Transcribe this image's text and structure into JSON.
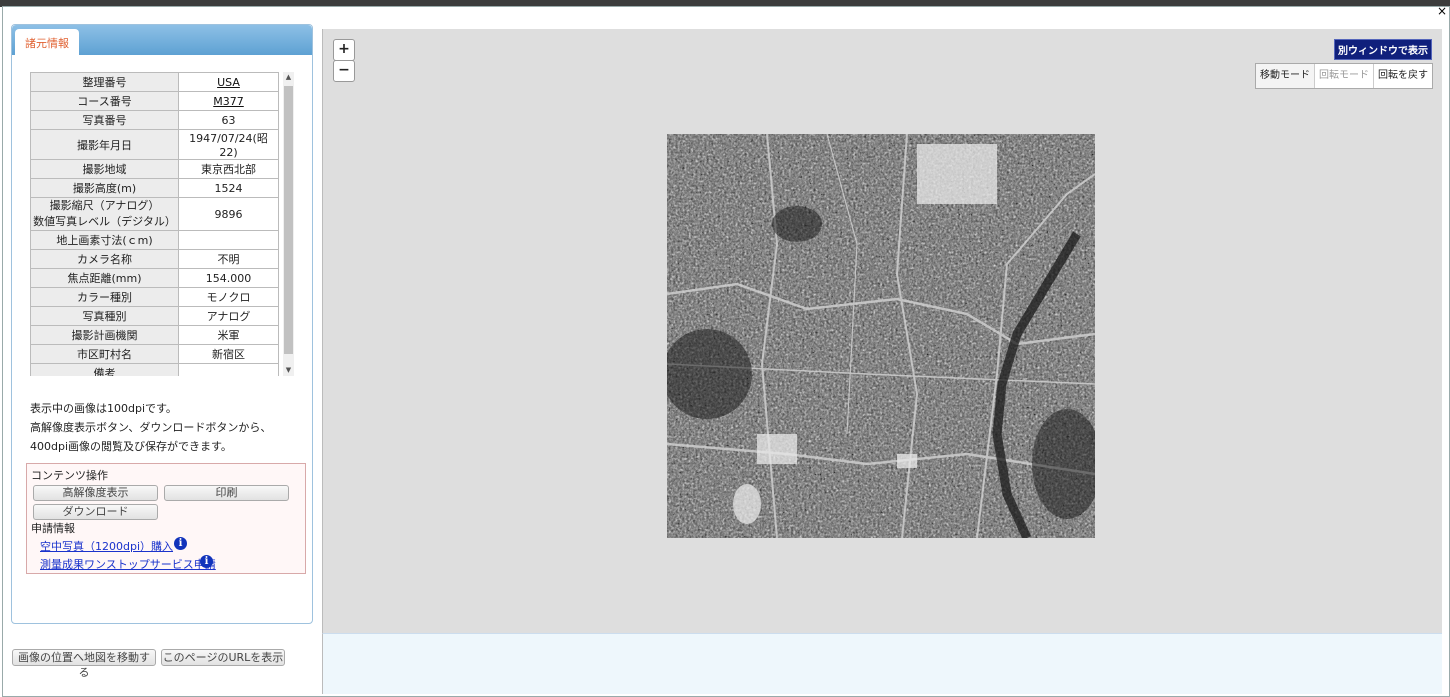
{
  "dialog": {
    "close_glyph": "×"
  },
  "left": {
    "tab": "諸元情報",
    "rows": [
      {
        "k": "整理番号",
        "v": "USA"
      },
      {
        "k": "コース番号",
        "v": "M377"
      },
      {
        "k": "写真番号",
        "v": "63"
      },
      {
        "k": "撮影年月日",
        "v": "1947/07/24(昭22)"
      },
      {
        "k": "撮影地域",
        "v": "東京西北部"
      },
      {
        "k": "撮影高度(m)",
        "v": "1524"
      },
      {
        "k": "撮影縮尺（アナログ）\n数値写真レベル（デジタル）",
        "v": "9896"
      },
      {
        "k": "地上画素寸法(ｃm)",
        "v": ""
      },
      {
        "k": "カメラ名称",
        "v": "不明"
      },
      {
        "k": "焦点距離(mm)",
        "v": "154.000"
      },
      {
        "k": "カラー種別",
        "v": "モノクロ"
      },
      {
        "k": "写真種別",
        "v": "アナログ"
      },
      {
        "k": "撮影計画機関",
        "v": "米軍"
      },
      {
        "k": "市区町村名",
        "v": "新宿区"
      },
      {
        "k": "備考",
        "v": ""
      }
    ],
    "note": "表示中の画像は100dpiです。\n高解像度表示ボタン、ダウンロードボタンから、400dpi画像の閲覧及び保存ができます。",
    "ops": {
      "title": "コンテンツ操作",
      "hires": "高解像度表示",
      "print": "印刷",
      "download": "ダウンロード",
      "apply_title": "申請情報",
      "link1": "空中写真（1200dpi）購入",
      "link2": "測量成果ワンストップサービス申請",
      "info_glyph": "i"
    },
    "bottom": {
      "move_map": "画像の位置へ地図を移動する",
      "show_url": "このページのURLを表示"
    }
  },
  "viewer": {
    "zoom_in": "+",
    "zoom_out": "−",
    "separate_window": "別ウィンドウで表示",
    "modes": [
      "移動モード",
      "回転モード",
      "回転を戻す"
    ]
  }
}
